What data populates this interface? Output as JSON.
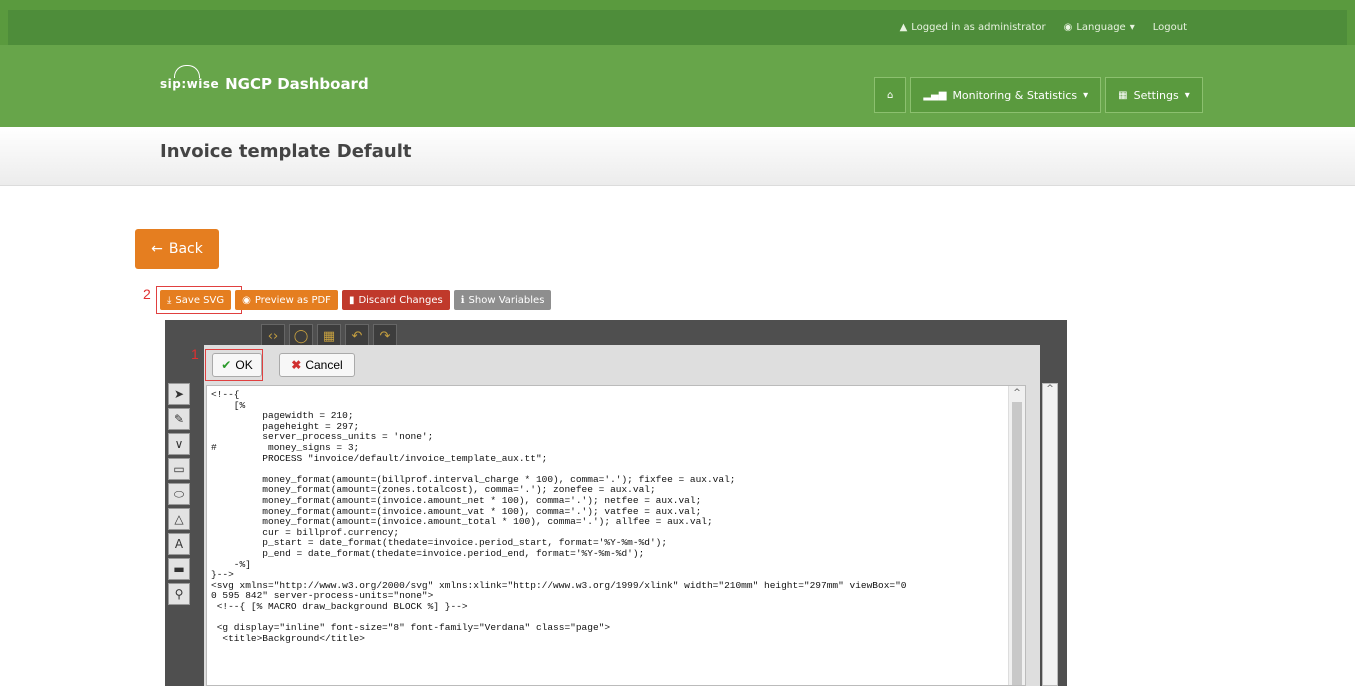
{
  "topbar": {
    "logged_in": "Logged in as administrator",
    "language": "Language",
    "logout": "Logout"
  },
  "header": {
    "brand": "sip:wise",
    "title": "NGCP Dashboard",
    "nav": {
      "monitoring": "Monitoring & Statistics",
      "settings": "Settings"
    }
  },
  "page": {
    "title": "Invoice template Default",
    "back": "Back"
  },
  "toolbar": {
    "save_svg": "Save SVG",
    "preview_pdf": "Preview as PDF",
    "discard": "Discard Changes",
    "show_vars": "Show Variables"
  },
  "annotations": {
    "one": "1",
    "two": "2"
  },
  "dialog": {
    "ok": "OK",
    "cancel": "Cancel",
    "code": "<!--{\n    [%\n         pagewidth = 210;\n         pageheight = 297;\n         server_process_units = 'none';\n#         money_signs = 3;\n         PROCESS \"invoice/default/invoice_template_aux.tt\";\n\n         money_format(amount=(billprof.interval_charge * 100), comma='.'); fixfee = aux.val;\n         money_format(amount=(zones.totalcost), comma='.'); zonefee = aux.val;\n         money_format(amount=(invoice.amount_net * 100), comma='.'); netfee = aux.val;\n         money_format(amount=(invoice.amount_vat * 100), comma='.'); vatfee = aux.val;\n         money_format(amount=(invoice.amount_total * 100), comma='.'); allfee = aux.val;\n         cur = billprof.currency;\n         p_start = date_format(thedate=invoice.period_start, format='%Y-%m-%d');\n         p_end = date_format(thedate=invoice.period_end, format='%Y-%m-%d');\n    -%]\n}-->\n<svg xmlns=\"http://www.w3.org/2000/svg\" xmlns:xlink=\"http://www.w3.org/1999/xlink\" width=\"210mm\" height=\"297mm\" viewBox=\"0\n0 595 842\" server-process-units=\"none\">\n <!--{ [% MACRO draw_background BLOCK %] }-->\n\n <g display=\"inline\" font-size=\"8\" font-family=\"Verdana\" class=\"page\">\n  <title>Background</title>"
  }
}
